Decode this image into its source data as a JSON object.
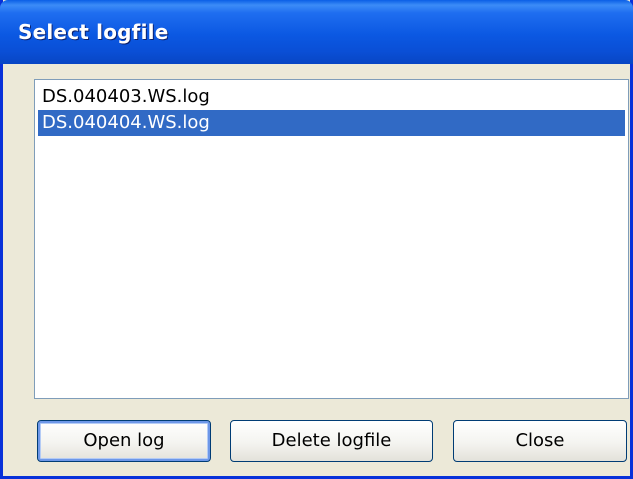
{
  "window": {
    "title": "Select logfile"
  },
  "logfiles": {
    "items": [
      {
        "label": "DS.040403.WS.log",
        "selected": false
      },
      {
        "label": "DS.040404.WS.log",
        "selected": true
      }
    ]
  },
  "buttons": {
    "open_label": "Open log",
    "delete_label": "Delete logfile",
    "close_label": "Close"
  },
  "colors": {
    "titlebar": "#0b58e2",
    "selection": "#316ac5",
    "dialog_background": "#ece9d8"
  }
}
